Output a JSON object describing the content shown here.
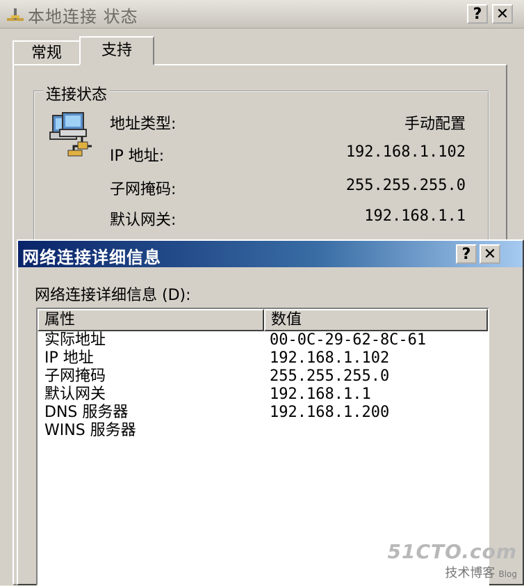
{
  "back_window": {
    "title": "本地连接 状态",
    "help_btn": "?",
    "close_btn": "✕",
    "tabs": [
      {
        "label": "常规"
      },
      {
        "label": "支持"
      }
    ],
    "group_title": "连接状态",
    "rows": [
      {
        "label": "地址类型:",
        "value": "手动配置"
      },
      {
        "label": "IP 地址:",
        "value": "192.168.1.102"
      },
      {
        "label": "子网掩码:",
        "value": "255.255.255.0"
      },
      {
        "label": "默认网关:",
        "value": "192.168.1.1"
      }
    ]
  },
  "dialog": {
    "title": "网络连接详细信息",
    "help_btn": "?",
    "close_btn": "✕",
    "list_label": "网络连接详细信息 (D):",
    "columns": [
      "属性",
      "数值"
    ],
    "rows": [
      {
        "attr": "实际地址",
        "val": "00-0C-29-62-8C-61"
      },
      {
        "attr": "IP 地址",
        "val": "192.168.1.102"
      },
      {
        "attr": "子网掩码",
        "val": "255.255.255.0"
      },
      {
        "attr": "默认网关",
        "val": "192.168.1.1"
      },
      {
        "attr": "DNS 服务器",
        "val": "192.168.1.200"
      },
      {
        "attr": "WINS 服务器",
        "val": ""
      }
    ]
  },
  "watermark": {
    "site": "51CTO.com",
    "sub": "技术博客",
    "blog": "Blog"
  },
  "colors": {
    "dialog_title_start": "#0a246a",
    "dialog_title_end": "#a6caf0",
    "face": "#d4d0c8"
  }
}
